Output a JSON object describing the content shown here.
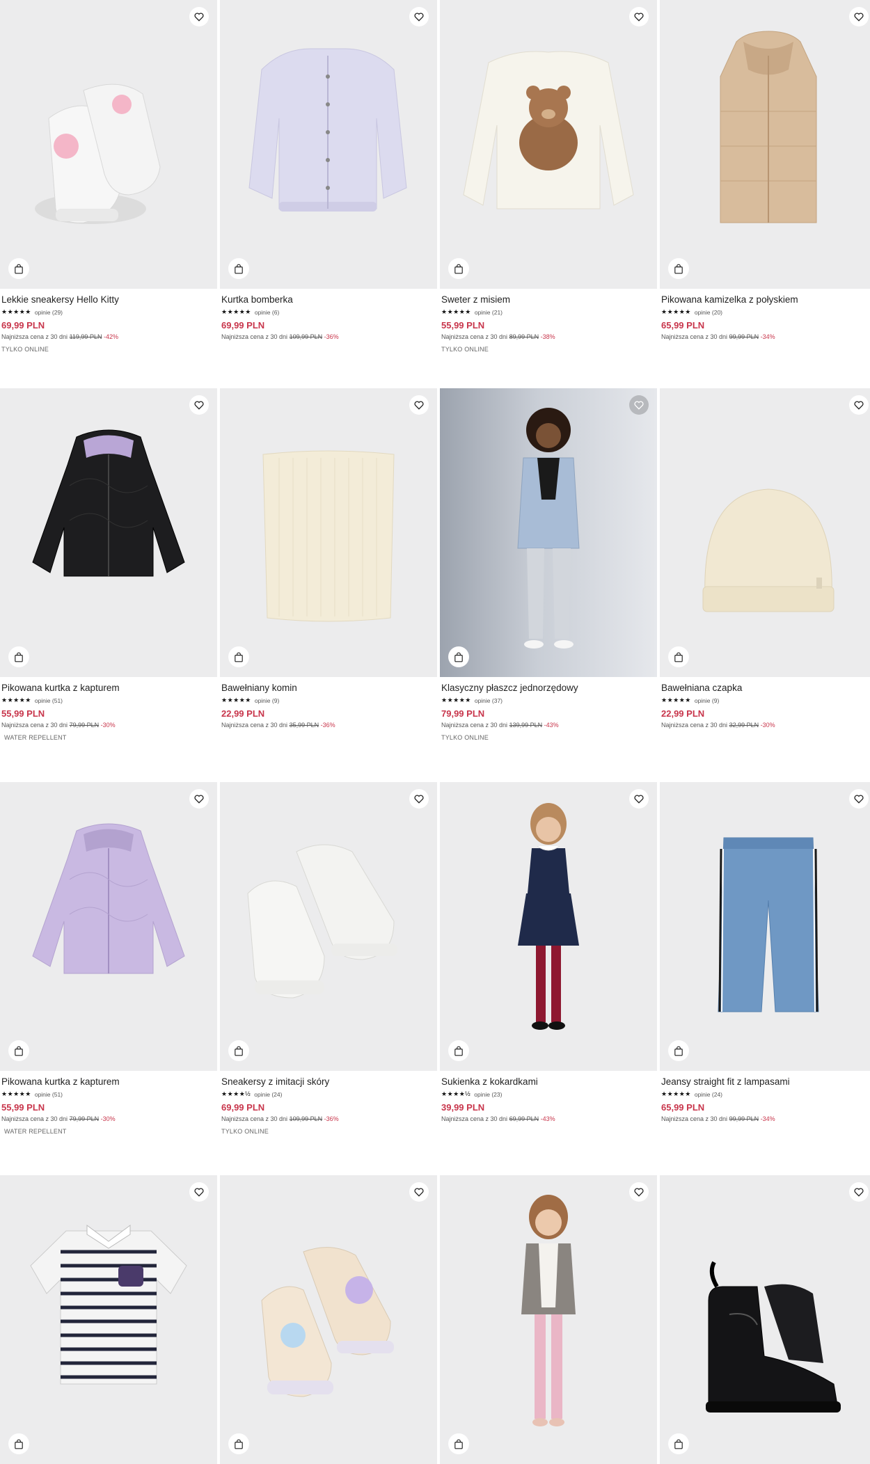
{
  "products": [
    {
      "name": "Lekkie sneakersy Hello Kitty",
      "stars": "★★★★★",
      "reviews": "opinie (29)",
      "price": "69,99 PLN",
      "lowest_label": "Najniższa cena z 30 dni",
      "old_price": "119,99 PLN",
      "discount": "-42%",
      "tag": "TYLKO ONLINE",
      "image": "sneakers-hello-kitty",
      "heart_icon": "heart-icon",
      "bag_icon": "shopping-bag-icon"
    },
    {
      "name": "Kurtka bomberka",
      "stars": "★★★★★",
      "reviews": "opinie (6)",
      "price": "69,99 PLN",
      "lowest_label": "Najniższa cena z 30 dni",
      "old_price": "109,99 PLN",
      "discount": "-36%",
      "tag": "",
      "image": "lilac-bomber-jacket",
      "heart_icon": "heart-icon",
      "bag_icon": "shopping-bag-icon"
    },
    {
      "name": "Sweter z misiem",
      "stars": "★★★★★",
      "reviews": "opinie (21)",
      "price": "55,99 PLN",
      "lowest_label": "Najniższa cena z 30 dni",
      "old_price": "89,99 PLN",
      "discount": "-38%",
      "tag": "TYLKO ONLINE",
      "image": "teddy-bear-sweater",
      "heart_icon": "heart-icon",
      "bag_icon": "shopping-bag-icon"
    },
    {
      "name": "Pikowana kamizelka z połyskiem",
      "stars": "★★★★★",
      "reviews": "opinie (20)",
      "price": "65,99 PLN",
      "lowest_label": "Najniższa cena z 30 dni",
      "old_price": "99,99 PLN",
      "discount": "-34%",
      "tag": "",
      "image": "beige-puffer-vest",
      "heart_icon": "heart-icon",
      "bag_icon": "shopping-bag-icon"
    },
    {
      "name": "Pikowana kurtka z kapturem",
      "stars": "★★★★★",
      "reviews": "opinie (51)",
      "price": "55,99 PLN",
      "lowest_label": "Najniższa cena z 30 dni",
      "old_price": "79,99 PLN",
      "discount": "-30%",
      "tag": "WATER REPELLENT",
      "image": "black-quilted-jacket",
      "heart_icon": "heart-icon",
      "bag_icon": "shopping-bag-icon"
    },
    {
      "name": "Bawełniany komin",
      "stars": "★★★★★",
      "reviews": "opinie (9)",
      "price": "22,99 PLN",
      "lowest_label": "Najniższa cena z 30 dni",
      "old_price": "35,99 PLN",
      "discount": "-36%",
      "tag": "",
      "image": "cream-snood",
      "heart_icon": "heart-icon",
      "bag_icon": "shopping-bag-icon"
    },
    {
      "name": "Klasyczny płaszcz jednorzędowy",
      "stars": "★★★★★",
      "reviews": "opinie (37)",
      "price": "79,99 PLN",
      "lowest_label": "Najniższa cena z 30 dni",
      "old_price": "139,99 PLN",
      "discount": "-43%",
      "tag": "TYLKO ONLINE",
      "image": "girl-blue-coat",
      "heart_icon": "heart-icon",
      "bag_icon": "shopping-bag-icon"
    },
    {
      "name": "Bawełniana czapka",
      "stars": "★★★★★",
      "reviews": "opinie (9)",
      "price": "22,99 PLN",
      "lowest_label": "Najniższa cena z 30 dni",
      "old_price": "32,99 PLN",
      "discount": "-30%",
      "tag": "",
      "image": "cream-beanie",
      "heart_icon": "heart-icon",
      "bag_icon": "shopping-bag-icon"
    },
    {
      "name": "Pikowana kurtka z kapturem",
      "stars": "★★★★★",
      "reviews": "opinie (51)",
      "price": "55,99 PLN",
      "lowest_label": "Najniższa cena z 30 dni",
      "old_price": "79,99 PLN",
      "discount": "-30%",
      "tag": "WATER REPELLENT",
      "image": "lilac-quilted-jacket",
      "heart_icon": "heart-icon",
      "bag_icon": "shopping-bag-icon"
    },
    {
      "name": "Sneakersy z imitacji skóry",
      "stars": "★★★★½",
      "reviews": "opinie (24)",
      "price": "69,99 PLN",
      "lowest_label": "Najniższa cena z 30 dni",
      "old_price": "109,99 PLN",
      "discount": "-36%",
      "tag": "TYLKO ONLINE",
      "image": "white-sneakers",
      "heart_icon": "heart-icon",
      "bag_icon": "shopping-bag-icon"
    },
    {
      "name": "Sukienka z kokardkami",
      "stars": "★★★★½",
      "reviews": "opinie (23)",
      "price": "39,99 PLN",
      "lowest_label": "Najniższa cena z 30 dni",
      "old_price": "69,99 PLN",
      "discount": "-43%",
      "tag": "",
      "image": "girl-navy-dress",
      "heart_icon": "heart-icon",
      "bag_icon": "shopping-bag-icon"
    },
    {
      "name": "Jeansy straight fit z lampasami",
      "stars": "★★★★★",
      "reviews": "opinie (24)",
      "price": "65,99 PLN",
      "lowest_label": "Najniższa cena z 30 dni",
      "old_price": "99,99 PLN",
      "discount": "-34%",
      "tag": "",
      "image": "striped-jeans",
      "heart_icon": "heart-icon",
      "bag_icon": "shopping-bag-icon"
    },
    {
      "name": "",
      "stars": "",
      "reviews": "",
      "price": "",
      "lowest_label": "",
      "old_price": "",
      "discount": "",
      "tag": "",
      "image": "striped-polo-shirt",
      "heart_icon": "heart-icon",
      "bag_icon": "shopping-bag-icon"
    },
    {
      "name": "",
      "stars": "",
      "reviews": "",
      "price": "",
      "lowest_label": "",
      "old_price": "",
      "discount": "",
      "tag": "",
      "image": "unicorn-sneakers",
      "heart_icon": "heart-icon",
      "bag_icon": "shopping-bag-icon"
    },
    {
      "name": "",
      "stars": "",
      "reviews": "",
      "price": "",
      "lowest_label": "",
      "old_price": "",
      "discount": "",
      "tag": "",
      "image": "girl-grey-cardigan",
      "heart_icon": "heart-icon",
      "bag_icon": "shopping-bag-icon"
    },
    {
      "name": "",
      "stars": "",
      "reviews": "",
      "price": "",
      "lowest_label": "",
      "old_price": "",
      "discount": "",
      "tag": "",
      "image": "black-patent-boots",
      "heart_icon": "heart-icon",
      "bag_icon": "shopping-bag-icon"
    }
  ],
  "colors": {
    "price": "#c8354b",
    "background": "#ececed",
    "text": "#222222"
  }
}
